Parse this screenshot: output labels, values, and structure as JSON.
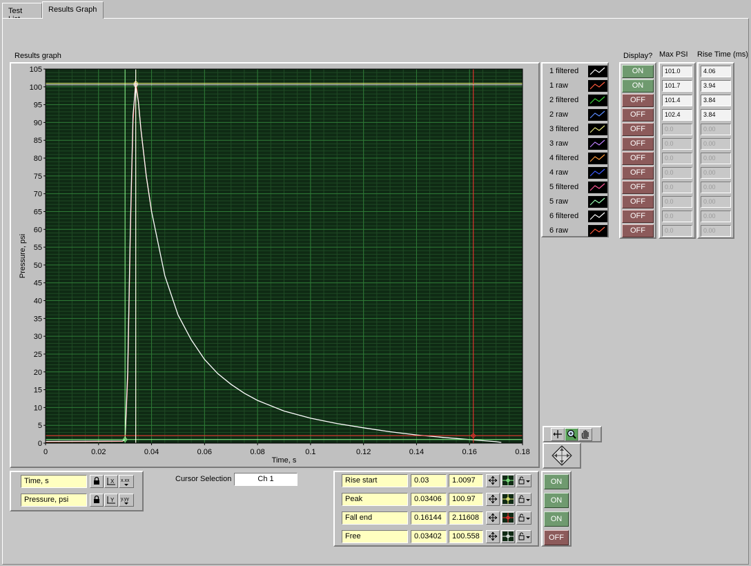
{
  "tabs": [
    {
      "label": "Test List",
      "active": false
    },
    {
      "label": "Results Graph",
      "active": true
    }
  ],
  "graph": {
    "title": "Results graph",
    "xlabel": "Time, s",
    "ylabel": "Pressure, psi"
  },
  "chart_data": {
    "type": "line",
    "title": "Results graph",
    "xlabel": "Time, s",
    "ylabel": "Pressure, psi",
    "xlim": [
      0,
      0.18
    ],
    "ylim": [
      0,
      105
    ],
    "x_ticks": [
      "0",
      "0.02",
      "0.04",
      "0.06",
      "0.08",
      "0.1",
      "0.12",
      "0.14",
      "0.16",
      "0.18"
    ],
    "y_ticks": [
      "0",
      "5",
      "10",
      "15",
      "20",
      "25",
      "30",
      "35",
      "40",
      "45",
      "50",
      "55",
      "60",
      "65",
      "70",
      "75",
      "80",
      "85",
      "90",
      "95",
      "100",
      "105"
    ],
    "grid": true,
    "background": "#0f2a14",
    "series": [
      {
        "name": "1 filtered",
        "color": "#ffffff",
        "x": [
          0,
          0.029,
          0.03,
          0.031,
          0.032,
          0.033,
          0.034,
          0.035,
          0.036,
          0.038,
          0.04,
          0.045,
          0.05,
          0.055,
          0.06,
          0.065,
          0.07,
          0.075,
          0.08,
          0.09,
          0.1,
          0.11,
          0.12,
          0.13,
          0.14,
          0.15,
          0.16,
          0.165,
          0.17,
          0.172
        ],
        "y": [
          0.5,
          0.6,
          1.0,
          20,
          60,
          92,
          100.5,
          96,
          88,
          75,
          65,
          47,
          36,
          29,
          23.5,
          19.5,
          16.5,
          14,
          12,
          9,
          7,
          5.5,
          4.3,
          3.2,
          2.3,
          1.6,
          1.0,
          0.7,
          0.4,
          0.2
        ]
      },
      {
        "name": "1 raw",
        "color": "#ff4040",
        "x": [
          0,
          0.029,
          0.03,
          0.031,
          0.032,
          0.033,
          0.034,
          0.035,
          0.036,
          0.038,
          0.04
        ],
        "y": [
          0.4,
          0.5,
          1.0,
          18,
          58,
          90,
          101.7,
          96,
          88,
          75,
          65
        ]
      }
    ],
    "cursors": [
      {
        "name": "Rise start",
        "x": 0.03,
        "y": 1.0097,
        "color": "#90ff90"
      },
      {
        "name": "Peak",
        "x": 0.03406,
        "y": 100.97,
        "color": "#ffff80"
      },
      {
        "name": "Fall end",
        "x": 0.16144,
        "y": 2.11608,
        "color": "#ff3030"
      },
      {
        "name": "Free",
        "x": 0.03402,
        "y": 100.558,
        "color": "#ffffff"
      }
    ]
  },
  "legend": {
    "items": [
      {
        "name": "1 filtered",
        "color": "#ffffff"
      },
      {
        "name": "1 raw",
        "color": "#ff5a3c"
      },
      {
        "name": "2 filtered",
        "color": "#39d439"
      },
      {
        "name": "2 raw",
        "color": "#5a8cff"
      },
      {
        "name": "3 filtered",
        "color": "#e6e680"
      },
      {
        "name": "3 raw",
        "color": "#c080ff"
      },
      {
        "name": "4 filtered",
        "color": "#ff9a3c"
      },
      {
        "name": "4 raw",
        "color": "#3c5aff"
      },
      {
        "name": "5 filtered",
        "color": "#ff5a9a"
      },
      {
        "name": "5 raw",
        "color": "#9affb4"
      },
      {
        "name": "6 filtered",
        "color": "#ffffff"
      },
      {
        "name": "6 raw",
        "color": "#ff5a3c"
      }
    ]
  },
  "columns": {
    "display_header": "Display?",
    "maxpsi_header": "Max PSI",
    "risetime_header": "Rise Time (ms)"
  },
  "rows": [
    {
      "display": "ON",
      "maxpsi": "101.0",
      "rise": "4.06"
    },
    {
      "display": "ON",
      "maxpsi": "101.7",
      "rise": "3.94"
    },
    {
      "display": "OFF",
      "maxpsi": "101.4",
      "rise": "3.84"
    },
    {
      "display": "OFF",
      "maxpsi": "102.4",
      "rise": "3.84"
    },
    {
      "display": "OFF",
      "maxpsi": "0.0",
      "rise": "0.00"
    },
    {
      "display": "OFF",
      "maxpsi": "0.0",
      "rise": "0.00"
    },
    {
      "display": "OFF",
      "maxpsi": "0.0",
      "rise": "0.00"
    },
    {
      "display": "OFF",
      "maxpsi": "0.0",
      "rise": "0.00"
    },
    {
      "display": "OFF",
      "maxpsi": "0.0",
      "rise": "0.00"
    },
    {
      "display": "OFF",
      "maxpsi": "0.0",
      "rise": "0.00"
    },
    {
      "display": "OFF",
      "maxpsi": "0.0",
      "rise": "0.00"
    },
    {
      "display": "OFF",
      "maxpsi": "0.0",
      "rise": "0.00"
    }
  ],
  "scale_legend": {
    "x_name": "Time, s",
    "y_name": "Pressure, psi",
    "x_format_icon": "x.xx",
    "y_format_icon": "y.yy"
  },
  "cursor_selection": {
    "label": "Cursor Selection",
    "value": "Ch 1"
  },
  "cursor_table": [
    {
      "name": "Rise start",
      "x": "0.03",
      "y": "1.0097",
      "toggle": "ON"
    },
    {
      "name": "Peak",
      "x": "0.03406",
      "y": "100.97",
      "toggle": "ON"
    },
    {
      "name": "Fall end",
      "x": "0.16144",
      "y": "2.11608",
      "toggle": "ON"
    },
    {
      "name": "Free",
      "x": "0.03402",
      "y": "100.558",
      "toggle": "OFF"
    }
  ]
}
